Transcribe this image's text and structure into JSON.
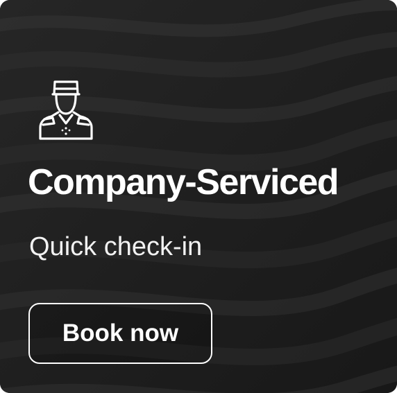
{
  "card": {
    "icon": "bellhop-icon",
    "title": "Company-Serviced",
    "subtitle": "Quick check-in",
    "button_label": "Book now"
  },
  "colors": {
    "background": "#1e1e1e",
    "text": "#ffffff",
    "button_border": "#ffffff"
  }
}
